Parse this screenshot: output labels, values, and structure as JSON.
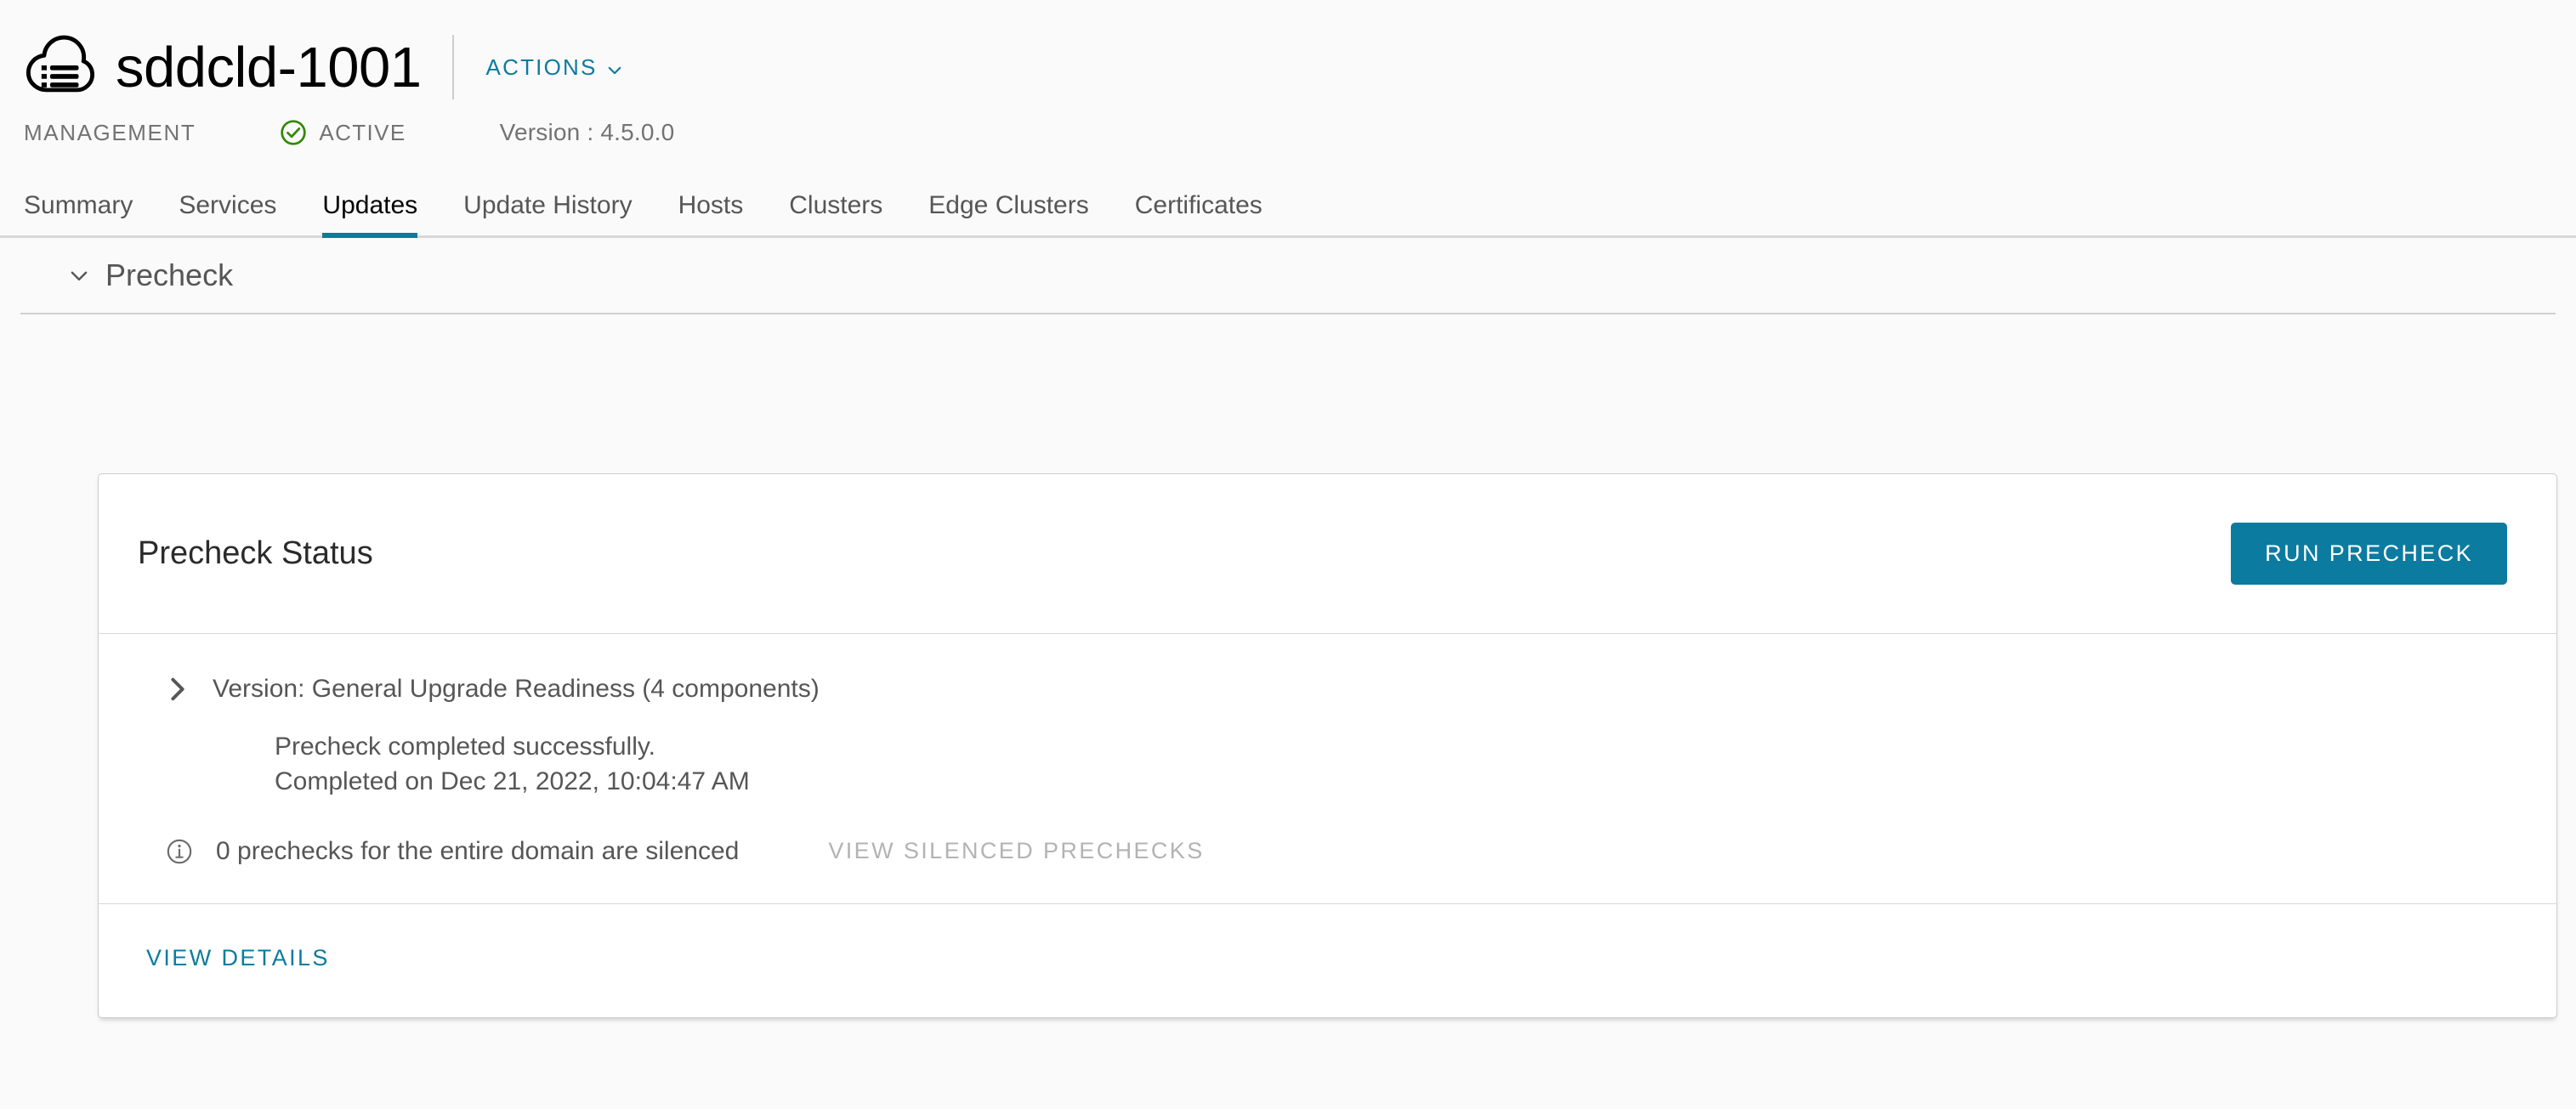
{
  "header": {
    "icon": "sddc-cloud-icon",
    "title": "sddcld-1001",
    "actions_label": "ACTIONS",
    "actions_caret": "chevron-down-icon"
  },
  "meta": {
    "domain_type": "MANAGEMENT",
    "status_icon": "success-check-circle-icon",
    "status_label": "ACTIVE",
    "version_label": "Version : 4.5.0.0",
    "status_color": "#318700"
  },
  "tabs": [
    {
      "label": "Summary",
      "active": false
    },
    {
      "label": "Services",
      "active": false
    },
    {
      "label": "Updates",
      "active": true
    },
    {
      "label": "Update History",
      "active": false
    },
    {
      "label": "Hosts",
      "active": false
    },
    {
      "label": "Clusters",
      "active": false
    },
    {
      "label": "Edge Clusters",
      "active": false
    },
    {
      "label": "Certificates",
      "active": false
    }
  ],
  "section": {
    "caret_icon": "chevron-down-icon",
    "title": "Precheck"
  },
  "card": {
    "title": "Precheck Status",
    "run_button_label": "RUN PRECHECK",
    "expand_caret_icon": "chevron-right-icon",
    "expand_label": "Version: General Upgrade Readiness (4 components)",
    "status_line_1": "Precheck completed successfully.",
    "status_line_2": "Completed on Dec 21, 2022, 10:04:47 AM",
    "info_icon": "info-circle-icon",
    "silenced_text": "0 prechecks for the entire domain are silenced",
    "silenced_link_label": "VIEW SILENCED PRECHECKS",
    "view_details_label": "VIEW DETAILS"
  },
  "colors": {
    "accent": "#0c7ba0",
    "success": "#318700",
    "text_muted": "#565656",
    "disabled": "#b3b3b3"
  }
}
